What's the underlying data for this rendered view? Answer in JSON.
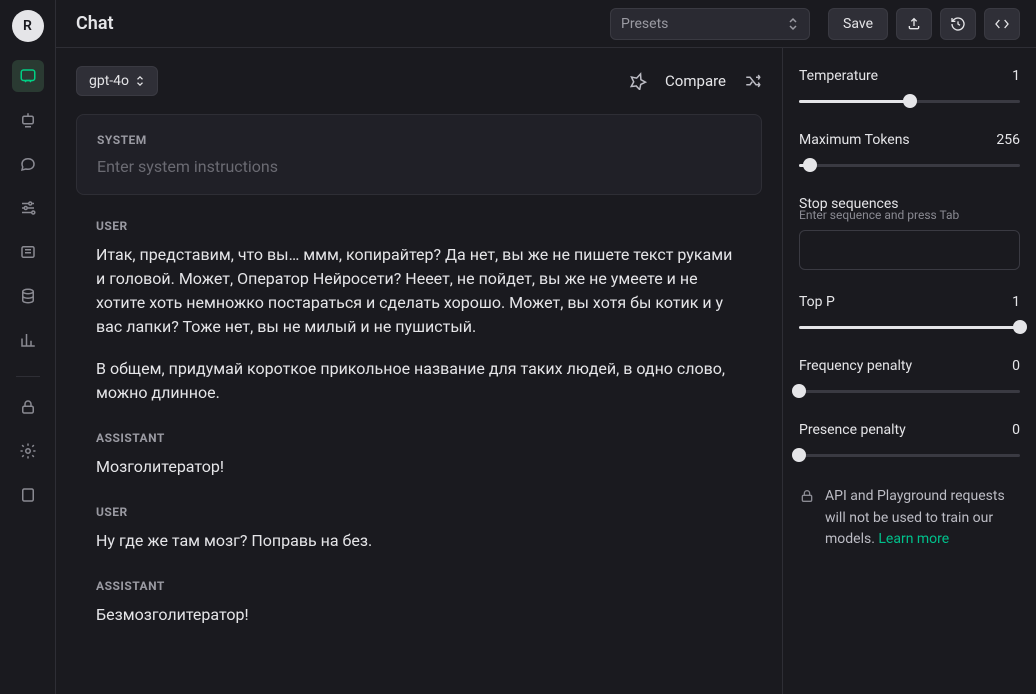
{
  "avatar_letter": "R",
  "topbar": {
    "title": "Chat",
    "presets_label": "Presets",
    "save_label": "Save"
  },
  "model": {
    "name": "gpt-4o",
    "compare_label": "Compare"
  },
  "system": {
    "role": "SYSTEM",
    "placeholder": "Enter system instructions"
  },
  "messages": [
    {
      "role": "USER",
      "paragraphs": [
        "Итак, представим, что вы… ммм, копирайтер? Да нет, вы же не пишете текст руками и головой. Может, Оператор Нейросети? Нееет, не пойдет, вы же не умеете и не хотите хоть немножко постараться и сделать хорошо. Может, вы хотя бы котик и у вас лапки? Тоже нет, вы не милый и не пушистый.",
        "В общем, придумай короткое прикольное название для таких людей, в одно слово, можно длинное."
      ]
    },
    {
      "role": "ASSISTANT",
      "paragraphs": [
        "Мозголитератор!"
      ]
    },
    {
      "role": "USER",
      "paragraphs": [
        "Ну где же там мозг? Поправь на без."
      ]
    },
    {
      "role": "ASSISTANT",
      "paragraphs": [
        "Безмозголитератор!"
      ]
    }
  ],
  "settings": {
    "temperature": {
      "label": "Temperature",
      "value": "1",
      "fill_pct": 50
    },
    "max_tokens": {
      "label": "Maximum Tokens",
      "value": "256",
      "fill_pct": 5
    },
    "stop": {
      "label": "Stop sequences",
      "sublabel": "Enter sequence and press Tab"
    },
    "top_p": {
      "label": "Top P",
      "value": "1",
      "fill_pct": 100
    },
    "freq_penalty": {
      "label": "Frequency penalty",
      "value": "0",
      "fill_pct": 0
    },
    "pres_penalty": {
      "label": "Presence penalty",
      "value": "0",
      "fill_pct": 0
    }
  },
  "info": {
    "text": "API and Playground requests will not be used to train our models. ",
    "link_label": "Learn more"
  }
}
